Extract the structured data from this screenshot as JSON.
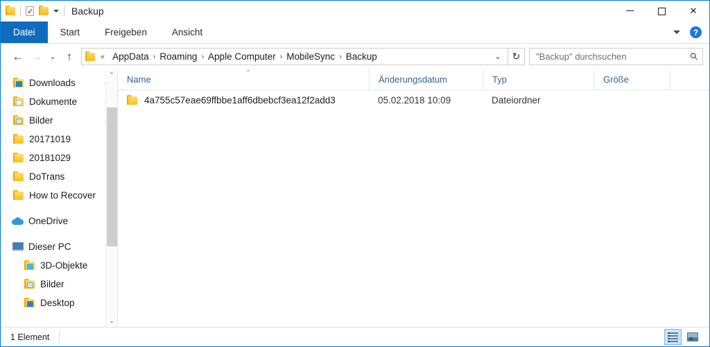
{
  "window": {
    "title": "Backup",
    "quick_access": [
      {
        "name": "folder-icon",
        "label": "Folder"
      },
      {
        "name": "properties-icon",
        "label": "Properties"
      },
      {
        "name": "new-folder-icon",
        "label": "New folder"
      }
    ],
    "controls": {
      "minimize": "—",
      "maximize": "□",
      "close": "✕"
    }
  },
  "ribbon": {
    "tabs": [
      {
        "label": "Datei",
        "active": true
      },
      {
        "label": "Start",
        "active": false
      },
      {
        "label": "Freigeben",
        "active": false
      },
      {
        "label": "Ansicht",
        "active": false
      }
    ],
    "expand_label": "⌄",
    "help_label": "?"
  },
  "navigation": {
    "back": "←",
    "forward": "→",
    "recent": "⌄",
    "up": "↑",
    "overflow": "«",
    "separator": "›",
    "breadcrumbs": [
      "AppData",
      "Roaming",
      "Apple Computer",
      "MobileSync",
      "Backup"
    ],
    "dropdown": "⌄",
    "refresh": "↻"
  },
  "search": {
    "placeholder": "\"Backup\" durchsuchen",
    "icon": "⚲"
  },
  "sidebar": {
    "quick_items": [
      {
        "label": "Downloads",
        "icon": "folder-download-icon",
        "pinned": true
      },
      {
        "label": "Dokumente",
        "icon": "folder-documents-icon",
        "pinned": true
      },
      {
        "label": "Bilder",
        "icon": "folder-pictures-icon",
        "pinned": true
      },
      {
        "label": "20171019",
        "icon": "folder-icon",
        "pinned": false
      },
      {
        "label": "20181029",
        "icon": "folder-icon",
        "pinned": false
      },
      {
        "label": "DoTrans",
        "icon": "folder-icon",
        "pinned": false
      },
      {
        "label": "How to Recover ",
        "icon": "folder-icon",
        "pinned": false
      }
    ],
    "onedrive": {
      "label": "OneDrive",
      "icon": "cloud-icon"
    },
    "this_pc": {
      "label": "Dieser PC",
      "icon": "computer-icon"
    },
    "pc_items": [
      {
        "label": "3D-Objekte",
        "icon": "folder-3d-icon"
      },
      {
        "label": "Bilder",
        "icon": "folder-pictures-icon"
      },
      {
        "label": "Desktop",
        "icon": "folder-desktop-icon"
      }
    ],
    "pin_glyph": "➤",
    "scroll_up": "⌃",
    "scroll_down": "⌄"
  },
  "filelist": {
    "columns": [
      {
        "label": "Name",
        "sorted": true
      },
      {
        "label": "Änderungsdatum",
        "sorted": false
      },
      {
        "label": "Typ",
        "sorted": false
      },
      {
        "label": "Größe",
        "sorted": false
      }
    ],
    "sort_caret": "⌃",
    "rows": [
      {
        "name": "4a755c57eae69ffbbe1aff6dbebcf3ea12f2add3",
        "modified": "05.02.2018 10:09",
        "type": "Dateiordner",
        "size": ""
      }
    ]
  },
  "statusbar": {
    "count": "1 Element",
    "views": [
      {
        "name": "details-view",
        "active": true
      },
      {
        "name": "large-icons-view",
        "active": false
      }
    ]
  },
  "colors": {
    "accent": "#0f6cbd",
    "window_border": "#0078d7",
    "column_header_text": "#38618c",
    "folder_yellow": "#f8c01c"
  }
}
